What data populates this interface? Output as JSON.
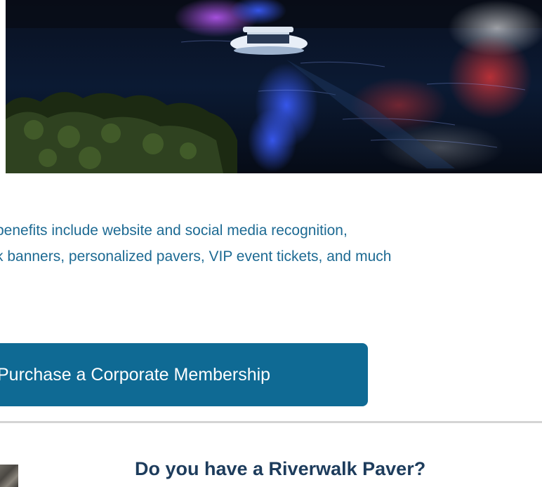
{
  "hero": {
    "alt": "Boat cruising on the river at night with colorful light reflections"
  },
  "content": {
    "benefits_line1": "benefits include website and social media recognition,",
    "benefits_line2": "k banners, personalized pavers, VIP event tickets, and much"
  },
  "cta": {
    "label": "Purchase a Corporate Membership"
  },
  "paver_section": {
    "heading": "Do you have a Riverwalk Paver?"
  },
  "colors": {
    "link_text": "#1d6a93",
    "button_bg": "#0f6a94",
    "heading": "#1d3c5c",
    "divider": "#d4d4d4"
  }
}
